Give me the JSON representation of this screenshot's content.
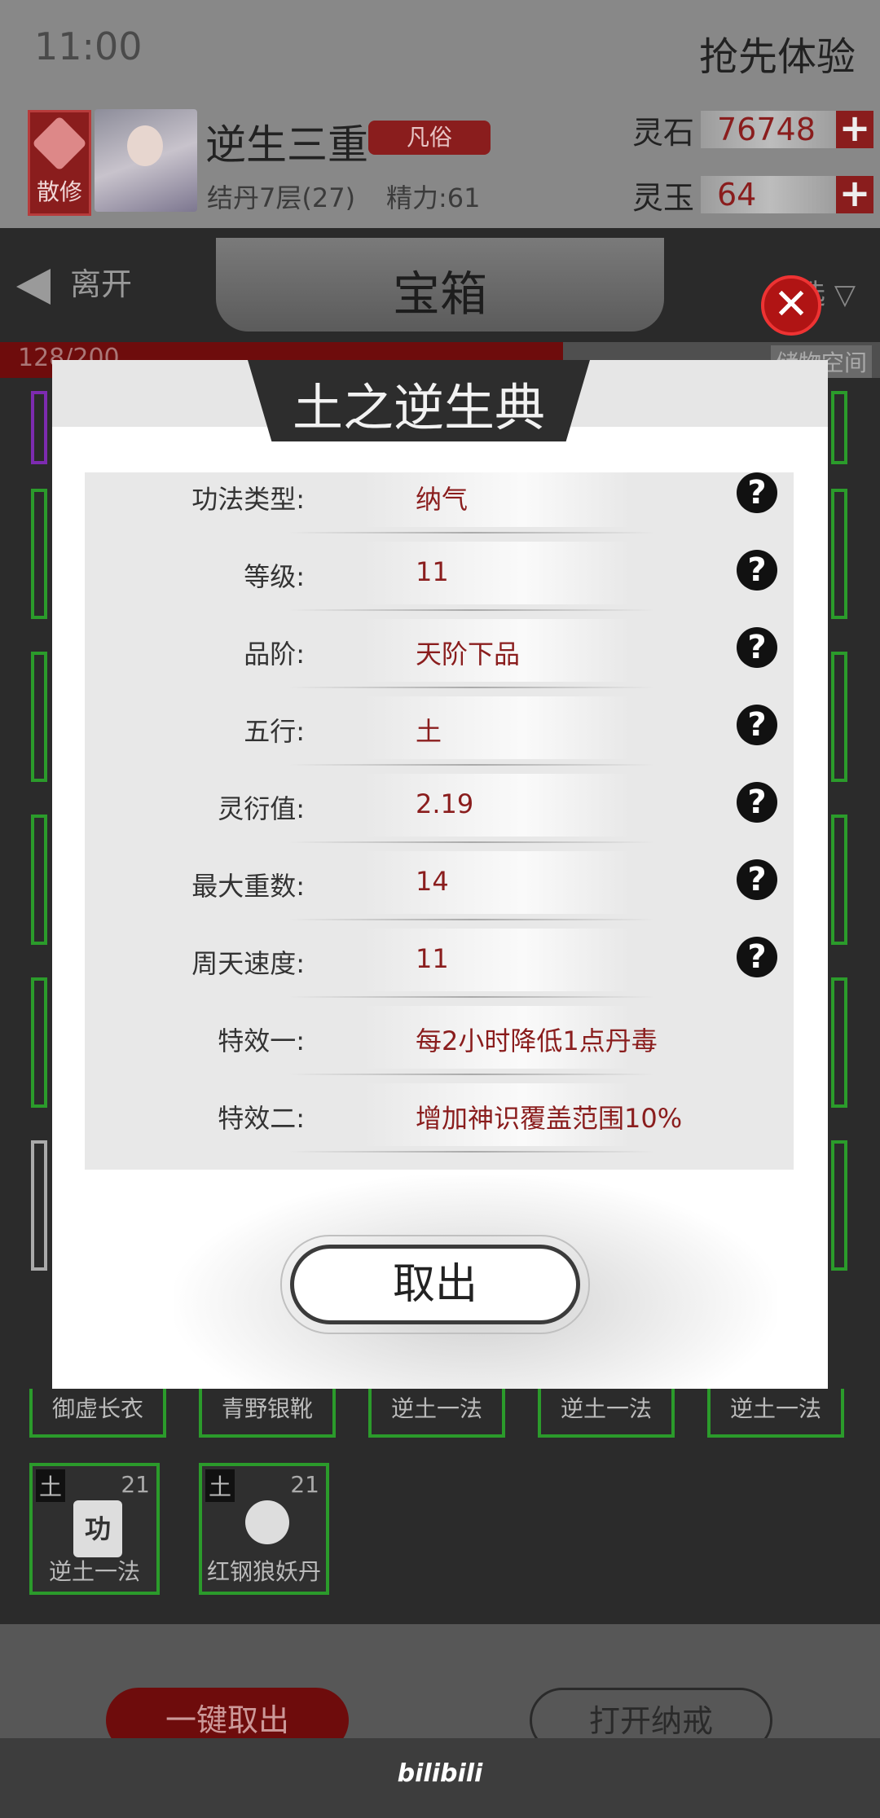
{
  "status": {
    "time": "11:00",
    "right_link": "抢先体验"
  },
  "player": {
    "rank_label": "散修",
    "name": "逆生三重",
    "realm_tag": "凡俗",
    "cultivation": "结丹7层(27)",
    "energy": "精力:61"
  },
  "currencies": [
    {
      "label": "灵石",
      "value": "76748"
    },
    {
      "label": "灵玉",
      "value": "64"
    }
  ],
  "nav": {
    "back_label": "离开",
    "title": "宝箱",
    "filter_label": "筛选",
    "capacity_text": "128/200",
    "capacity_fraction": 0.64,
    "space_label": "储物空间"
  },
  "grid": {
    "row_items": [
      {
        "name": "御虚长衣"
      },
      {
        "name": "青野银靴"
      },
      {
        "name": "逆土一法"
      },
      {
        "name": "逆土一法"
      },
      {
        "name": "逆土一法"
      }
    ],
    "bottom_items": [
      {
        "element": "土",
        "level": "21",
        "name": "逆土一法",
        "icon": "功"
      },
      {
        "element": "土",
        "level": "21",
        "name": "红钢狼妖丹",
        "icon": ""
      }
    ]
  },
  "footer": {
    "take_all": "一键取出",
    "open_ring": "打开纳戒"
  },
  "watermark": "bilibili",
  "modal": {
    "title": "土之逆生典",
    "attributes": [
      {
        "label": "功法类型:",
        "value": "纳气",
        "help": true
      },
      {
        "label": "等级:",
        "value": "11",
        "help": true
      },
      {
        "label": "品阶:",
        "value": "天阶下品",
        "help": true
      },
      {
        "label": "五行:",
        "value": "土",
        "help": true
      },
      {
        "label": "灵衍值:",
        "value": "2.19",
        "help": true
      },
      {
        "label": "最大重数:",
        "value": "14",
        "help": true
      },
      {
        "label": "周天速度:",
        "value": "11",
        "help": true
      },
      {
        "label": "特效一:",
        "value": "每2小时降低1点丹毒",
        "help": false
      },
      {
        "label": "特效二:",
        "value": "增加神识覆盖范围10%",
        "help": false
      }
    ],
    "take_button": "取出",
    "close_icon": "close-icon",
    "help_icon": "help-icon"
  }
}
